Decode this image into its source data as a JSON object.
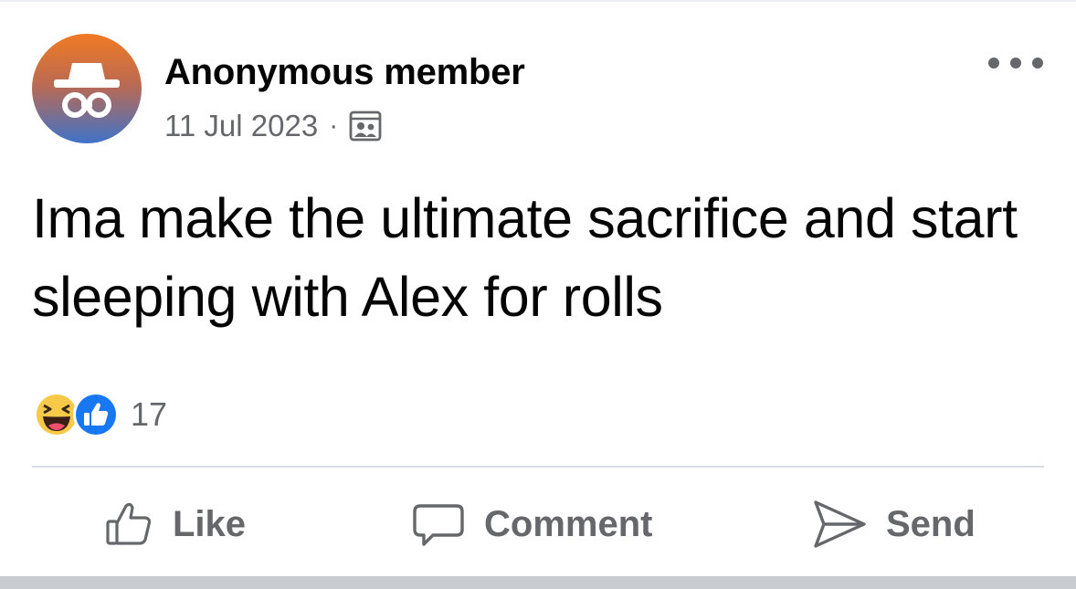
{
  "post": {
    "author": "Anonymous member",
    "date": "11 Jul 2023",
    "separator": "·",
    "audience_icon": "group-audience-icon",
    "avatar_icon": "anonymous-spy-icon",
    "more_icon": "more-options-icon",
    "text": "Ima make the ultimate sacrifice and start sleeping with Alex for rolls",
    "reactions": {
      "icons": [
        "haha-reaction-icon",
        "like-reaction-icon"
      ],
      "count": "17"
    }
  },
  "actions": {
    "like": {
      "label": "Like",
      "icon": "thumbs-up-icon"
    },
    "comment": {
      "label": "Comment",
      "icon": "comment-bubble-icon"
    },
    "send": {
      "label": "Send",
      "icon": "send-arrow-icon"
    }
  },
  "colors": {
    "text": "#050505",
    "secondary": "#65676b",
    "like_blue": "#1877f2",
    "haha_yellow": "#f7c948",
    "avatar_top": "#f07a23",
    "avatar_bottom": "#3f73c9"
  }
}
